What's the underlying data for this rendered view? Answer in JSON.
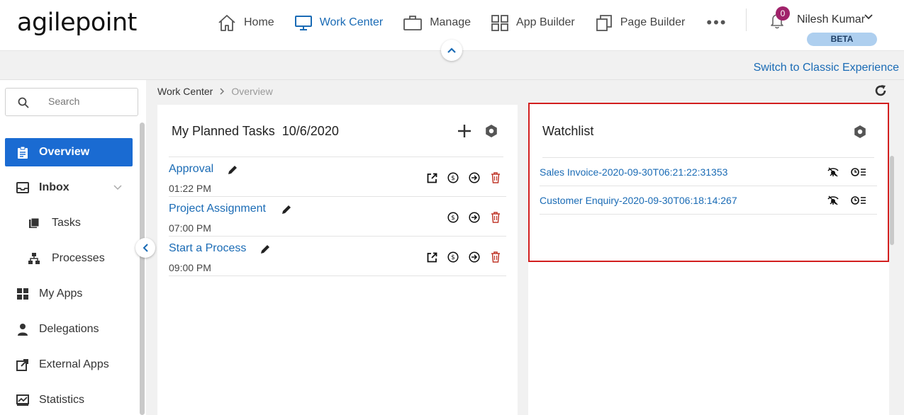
{
  "brand": {
    "logo_text": "agilepoint"
  },
  "nav": {
    "items": [
      {
        "label": "Home",
        "icon": "home-icon"
      },
      {
        "label": "Work Center",
        "icon": "monitor-icon",
        "active": true
      },
      {
        "label": "Manage",
        "icon": "briefcase-icon"
      },
      {
        "label": "App Builder",
        "icon": "grid-icon"
      },
      {
        "label": "Page Builder",
        "icon": "pages-icon"
      }
    ],
    "more_label": "•••"
  },
  "user": {
    "name": "Nilesh Kumar",
    "notification_count": "0",
    "badge": "BETA"
  },
  "classic_link": "Switch to Classic Experience",
  "search": {
    "placeholder": "Search"
  },
  "sidebar": {
    "items": [
      {
        "label": "Overview",
        "icon": "clipboard-icon",
        "active": true
      },
      {
        "label": "Inbox",
        "icon": "inbox-icon"
      },
      {
        "label": "Tasks",
        "icon": "tasks-icon"
      },
      {
        "label": "Processes",
        "icon": "processes-icon"
      },
      {
        "label": "My Apps",
        "icon": "apps-icon"
      },
      {
        "label": "Delegations",
        "icon": "person-icon"
      },
      {
        "label": "External Apps",
        "icon": "external-icon"
      },
      {
        "label": "Statistics",
        "icon": "chart-icon"
      }
    ]
  },
  "breadcrumb": {
    "root": "Work Center",
    "current": "Overview"
  },
  "planned_tasks": {
    "title": "My Planned Tasks",
    "date": "10/6/2020",
    "rows": [
      {
        "name": "Approval",
        "time": "01:22 PM"
      },
      {
        "name": "Project Assignment",
        "time": "07:00 PM"
      },
      {
        "name": "Start a Process",
        "time": "09:00 PM"
      }
    ]
  },
  "watchlist": {
    "title": "Watchlist",
    "rows": [
      {
        "name": "Sales Invoice-2020-09-30T06:21:22:31353"
      },
      {
        "name": "Customer Enquiry-2020-09-30T06:18:14:267"
      }
    ]
  },
  "colors": {
    "accent": "#1a6bb5",
    "active_bg": "#1a6bd2",
    "badge": "#a0226a",
    "delete": "#c0392b",
    "highlight": "#d21f1f"
  }
}
